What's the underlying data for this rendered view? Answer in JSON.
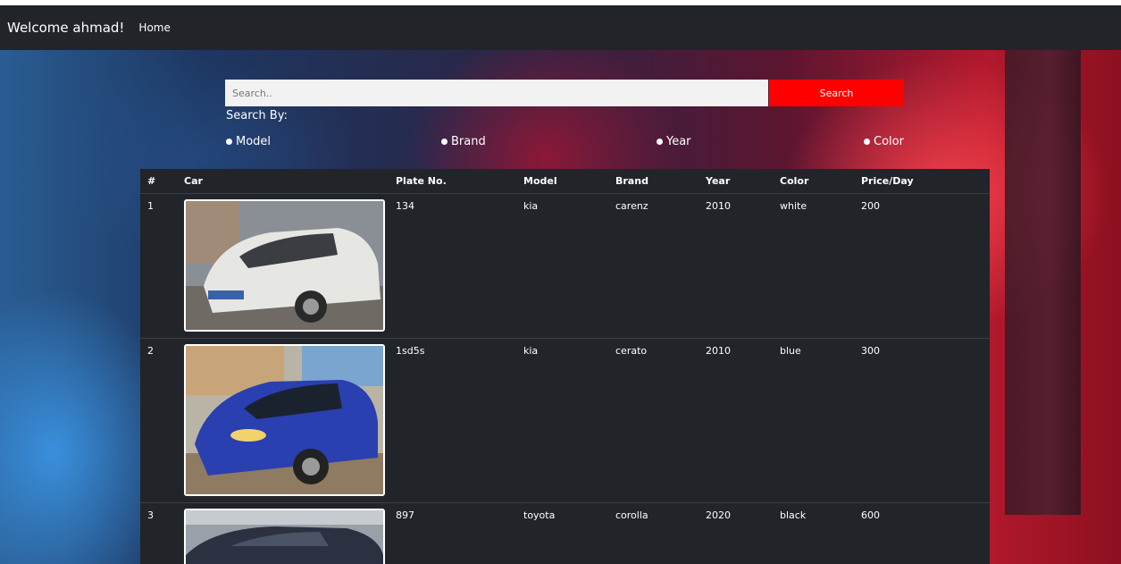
{
  "navbar": {
    "brand": "Welcome ahmad!",
    "home_link": "Home"
  },
  "search": {
    "placeholder": "Search..",
    "button_label": "Search",
    "search_by_label": "Search By:",
    "options": [
      "Model",
      "Brand",
      "Year",
      "Color"
    ]
  },
  "table": {
    "headers": [
      "#",
      "Car",
      "Plate No.",
      "Model",
      "Brand",
      "Year",
      "Color",
      "Price/Day"
    ],
    "rows": [
      {
        "index": "1",
        "plate": "134",
        "model": "kia",
        "brand": "carenz",
        "year": "2010",
        "color": "white",
        "price": "200"
      },
      {
        "index": "2",
        "plate": "1sd5s",
        "model": "kia",
        "brand": "cerato",
        "year": "2010",
        "color": "blue",
        "price": "300"
      },
      {
        "index": "3",
        "plate": "897",
        "model": "toyota",
        "brand": "corolla",
        "year": "2020",
        "color": "black",
        "price": "600"
      }
    ]
  },
  "colors": {
    "navbar_bg": "#212529",
    "table_bg": "#212529",
    "search_button": "#ff0000"
  }
}
